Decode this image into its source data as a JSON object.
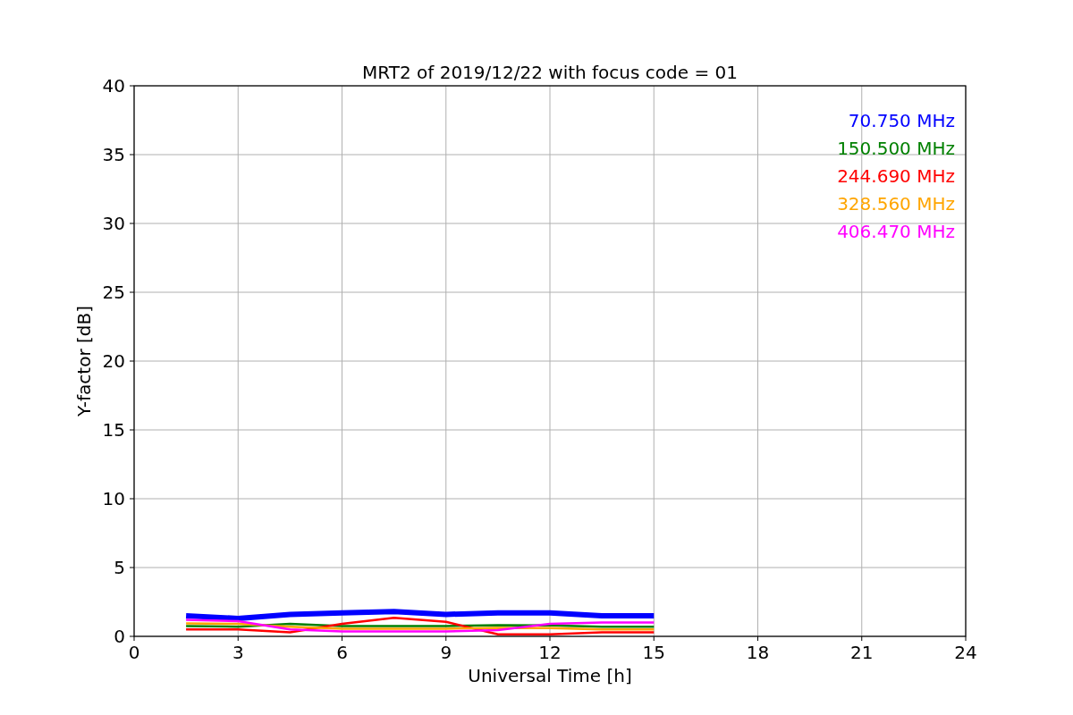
{
  "figure": {
    "chart_data": {
      "type": "line",
      "title": "MRT2 of 2019/12/22 with focus code = 01",
      "xlabel": "Universal Time [h]",
      "ylabel": "Y-factor [dB]",
      "x": [
        1.5,
        3,
        4.5,
        6,
        7.5,
        9,
        10.5,
        12,
        13.5,
        15
      ],
      "series": [
        {
          "name": "70.750 MHz",
          "color": "#0000ff",
          "values": [
            1.5,
            1.3,
            1.6,
            1.7,
            1.8,
            1.6,
            1.7,
            1.7,
            1.5,
            1.5
          ]
        },
        {
          "name": "150.500 MHz",
          "color": "#008000",
          "values": [
            0.75,
            0.7,
            0.9,
            0.75,
            0.75,
            0.75,
            0.82,
            0.8,
            0.7,
            0.7
          ]
        },
        {
          "name": "244.690 MHz",
          "color": "#ff0000",
          "values": [
            0.5,
            0.5,
            0.3,
            0.9,
            1.35,
            1.05,
            0.15,
            0.15,
            0.3,
            0.3
          ]
        },
        {
          "name": "328.560 MHz",
          "color": "#ffa500",
          "values": [
            0.95,
            0.9,
            0.7,
            0.55,
            0.55,
            0.55,
            0.62,
            0.6,
            0.5,
            0.5
          ]
        },
        {
          "name": "406.470 MHz",
          "color": "#ff00ff",
          "values": [
            1.2,
            1.1,
            0.5,
            0.35,
            0.35,
            0.35,
            0.45,
            0.9,
            1.0,
            1.0
          ]
        }
      ],
      "xlim": [
        0,
        24
      ],
      "ylim": [
        0,
        40
      ],
      "xticks": [
        0,
        3,
        6,
        9,
        12,
        15,
        18,
        21,
        24
      ],
      "yticks": [
        0,
        5,
        10,
        15,
        20,
        25,
        30,
        35,
        40
      ],
      "grid": true
    }
  }
}
